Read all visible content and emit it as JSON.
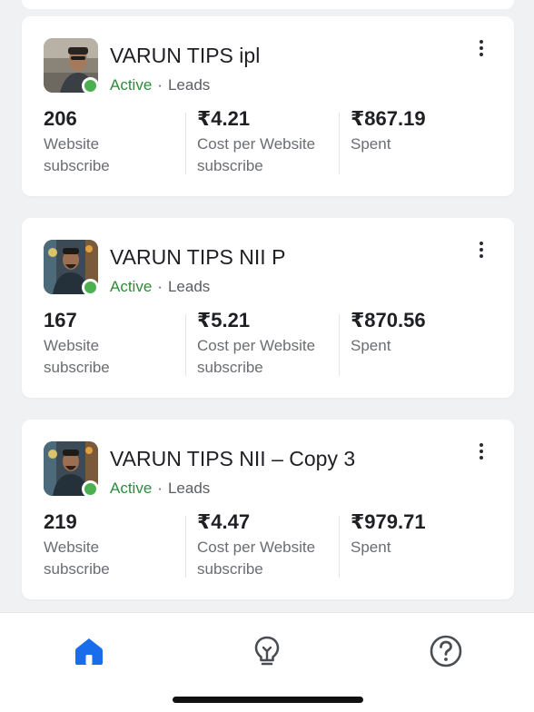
{
  "campaigns": [
    {
      "name": "VARUN TIPS ipl",
      "status": "Active",
      "separator": "·",
      "objective": "Leads",
      "metrics": [
        {
          "value": "206",
          "label": "Website subscribe"
        },
        {
          "value": "₹4.21",
          "label": "Cost per Website subscribe"
        },
        {
          "value": "₹867.19",
          "label": "Spent"
        }
      ]
    },
    {
      "name": "VARUN TIPS NII P",
      "status": "Active",
      "separator": "·",
      "objective": "Leads",
      "metrics": [
        {
          "value": "167",
          "label": "Website subscribe"
        },
        {
          "value": "₹5.21",
          "label": "Cost per Website subscribe"
        },
        {
          "value": "₹870.56",
          "label": "Spent"
        }
      ]
    },
    {
      "name": "VARUN TIPS NII – Copy 3",
      "status": "Active",
      "separator": "·",
      "objective": "Leads",
      "metrics": [
        {
          "value": "219",
          "label": "Website subscribe"
        },
        {
          "value": "₹4.47",
          "label": "Cost per Website subscribe"
        },
        {
          "value": "₹979.71",
          "label": "Spent"
        }
      ]
    }
  ],
  "bottom_nav": {
    "items": [
      {
        "icon": "home-icon",
        "active": true
      },
      {
        "icon": "lightbulb-icon",
        "active": false
      },
      {
        "icon": "help-icon",
        "active": false
      }
    ]
  },
  "colors": {
    "active_status": "#2e8b3b",
    "status_dot": "#4caf50",
    "nav_active": "#1a6dea",
    "nav_inactive": "#4a4d52"
  }
}
